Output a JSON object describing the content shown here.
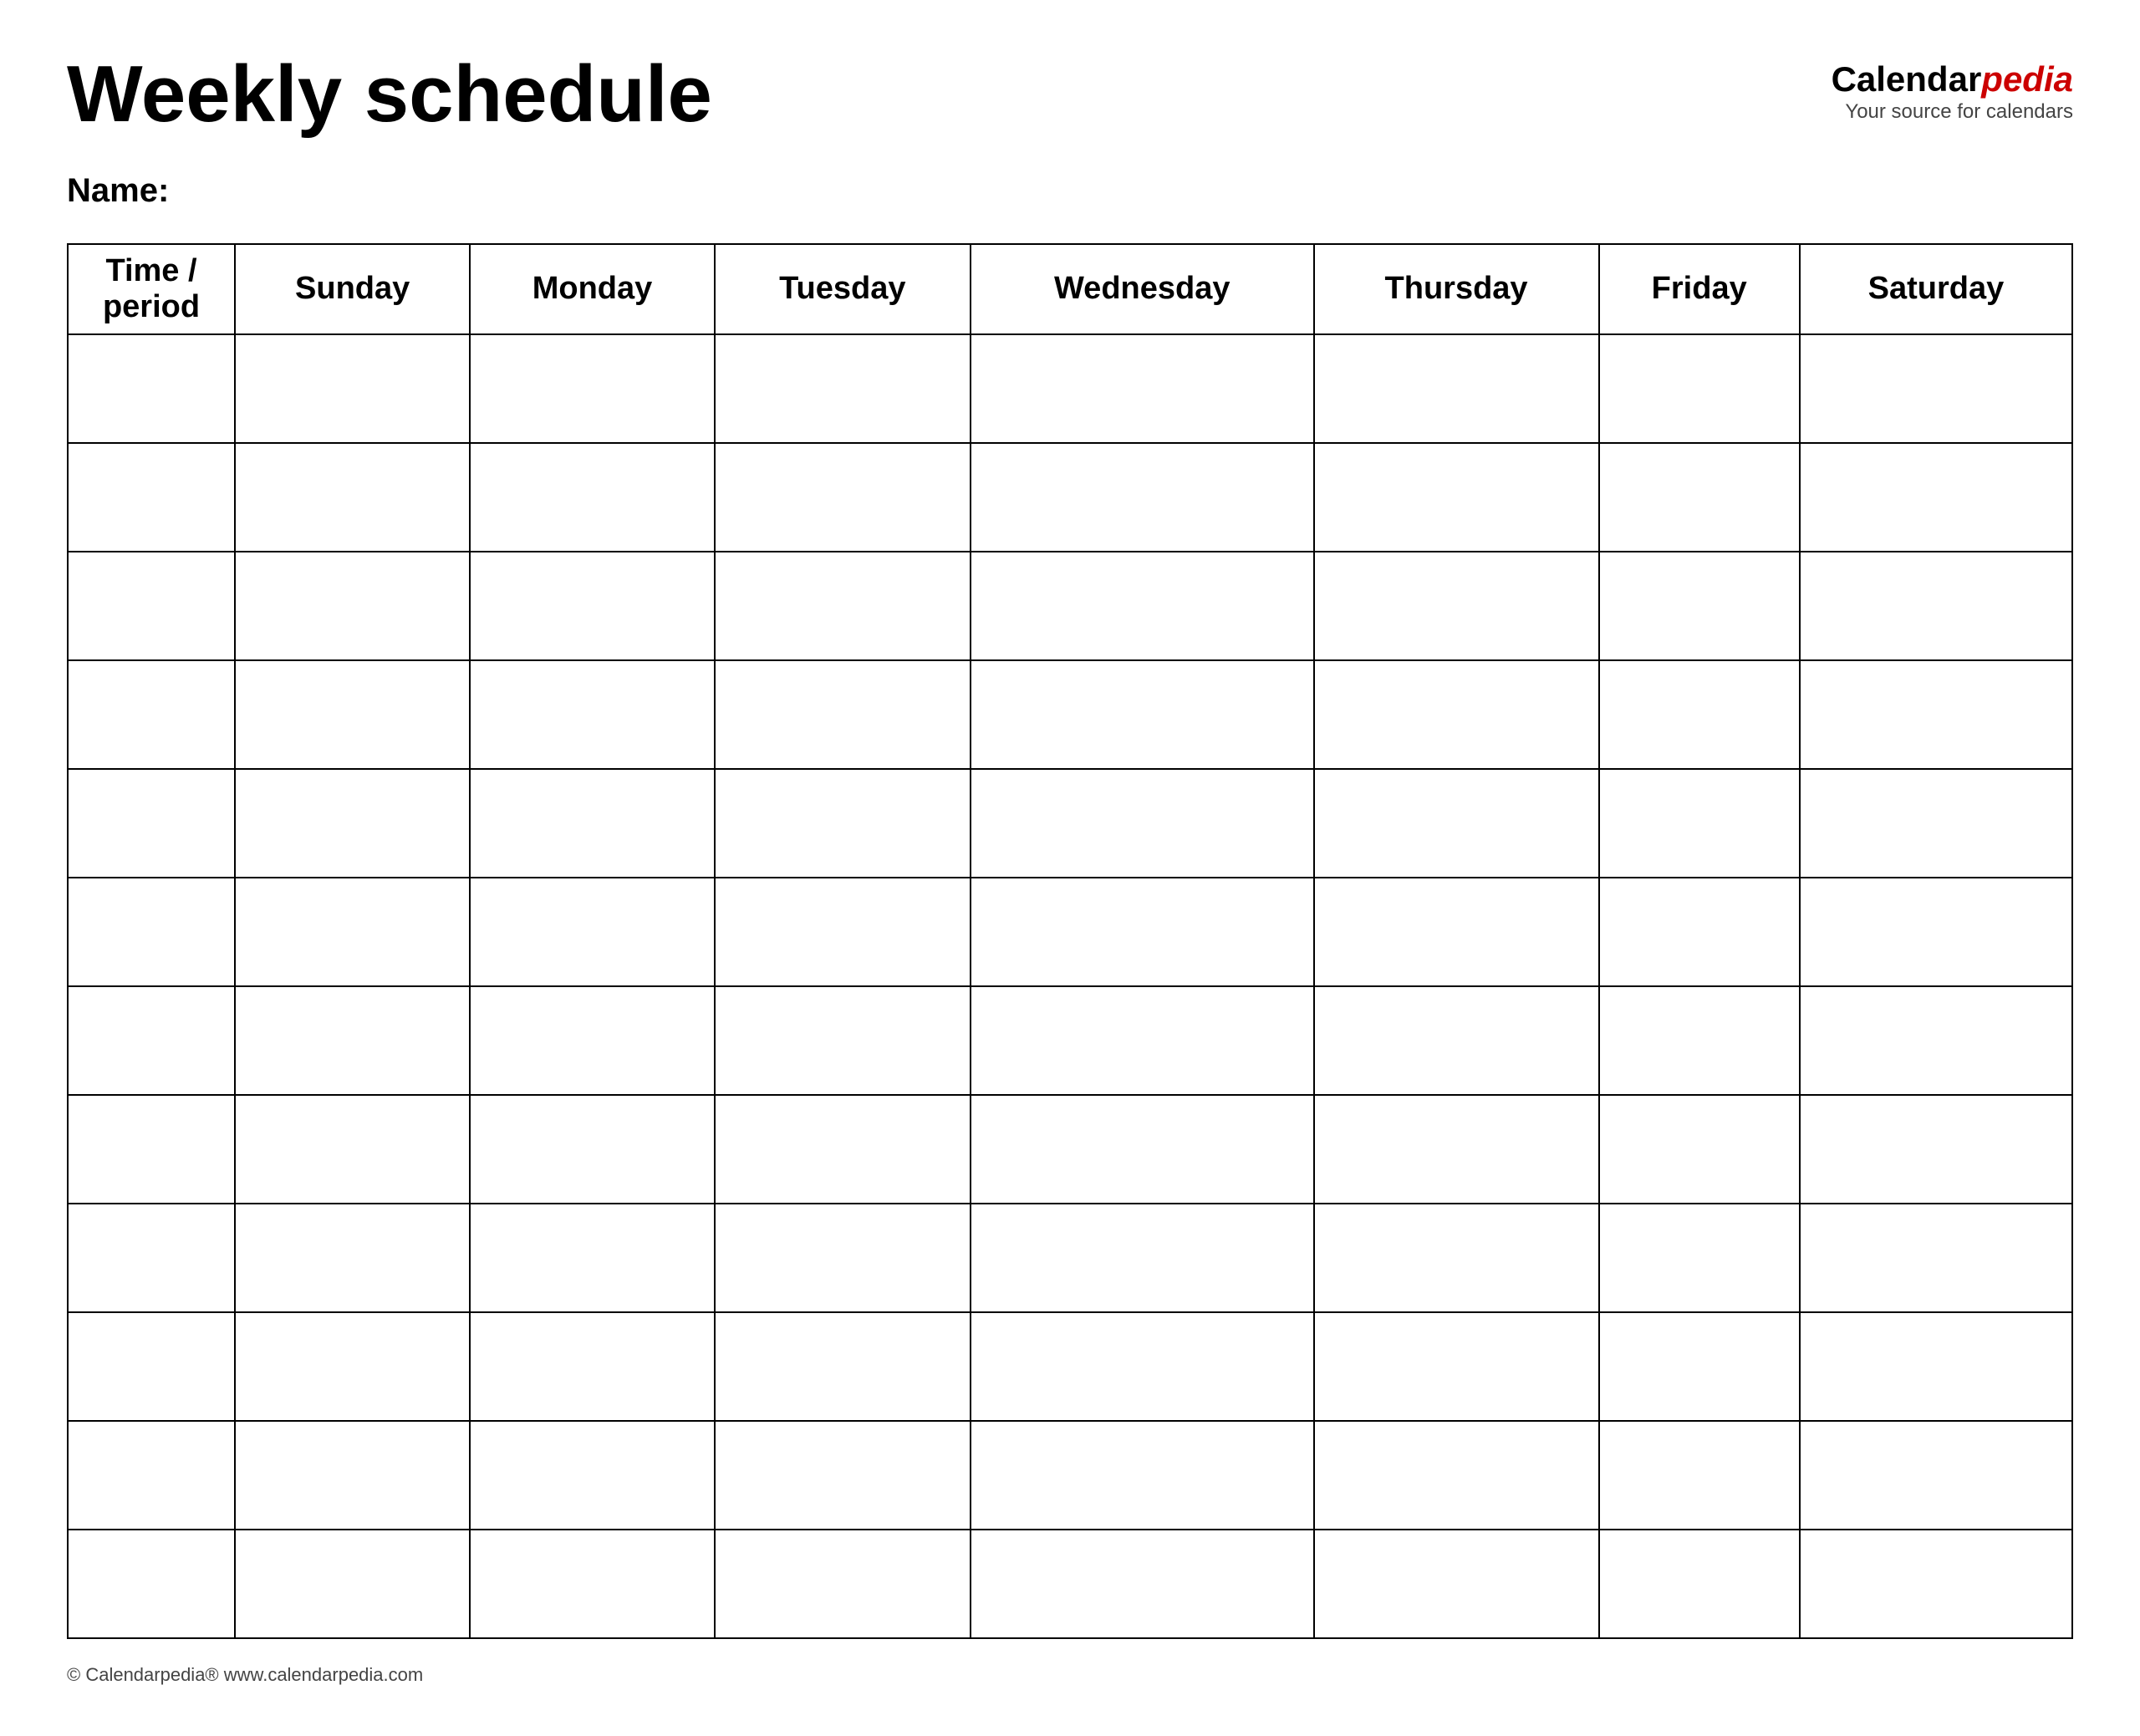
{
  "header": {
    "title": "Weekly schedule",
    "logo_calendar": "Calendar",
    "logo_pedia": "pedia",
    "logo_subtitle": "Your source for calendars"
  },
  "name_label": "Name:",
  "table": {
    "columns": [
      {
        "label": "Time / period",
        "key": "time"
      },
      {
        "label": "Sunday",
        "key": "sunday"
      },
      {
        "label": "Monday",
        "key": "monday"
      },
      {
        "label": "Tuesday",
        "key": "tuesday"
      },
      {
        "label": "Wednesday",
        "key": "wednesday"
      },
      {
        "label": "Thursday",
        "key": "thursday"
      },
      {
        "label": "Friday",
        "key": "friday"
      },
      {
        "label": "Saturday",
        "key": "saturday"
      }
    ],
    "row_count": 12
  },
  "footer": {
    "text": "© Calendarpedia®  www.calendarpedia.com"
  }
}
